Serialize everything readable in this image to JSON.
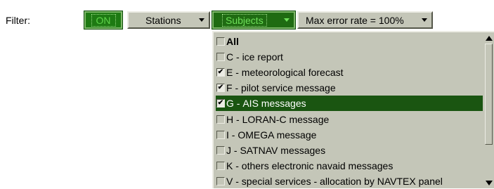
{
  "toolbar": {
    "filter_label": "Filter:",
    "on_label": "ON",
    "stations_label": "Stations",
    "subjects_label": "Subjects",
    "max_error_label": "Max error rate = 100%"
  },
  "subjects_list": {
    "items": [
      {
        "prefix": "",
        "text": "All",
        "checked": false,
        "selected": false
      },
      {
        "prefix": "C - ",
        "text": "ice report",
        "checked": false,
        "selected": false
      },
      {
        "prefix": "E - ",
        "text": "meteorological forecast",
        "checked": true,
        "selected": false
      },
      {
        "prefix": "F - ",
        "text": "pilot service message",
        "checked": true,
        "selected": false
      },
      {
        "prefix": "G - ",
        "text": "AIS messages",
        "checked": true,
        "selected": true
      },
      {
        "prefix": "H - ",
        "text": "LORAN-C message",
        "checked": false,
        "selected": false
      },
      {
        "prefix": "I - ",
        "text": "OMEGA message",
        "checked": false,
        "selected": false
      },
      {
        "prefix": "J - ",
        "text": "SATNAV messages",
        "checked": false,
        "selected": false
      },
      {
        "prefix": "K - ",
        "text": "others electronic navaid messages",
        "checked": false,
        "selected": false
      },
      {
        "prefix": "V - ",
        "text": "special services - allocation by NAVTEX panel",
        "checked": false,
        "selected": false
      }
    ]
  },
  "colors": {
    "panel": "#c4c6b8",
    "active_green": "#1f6b12",
    "selected_row": "#1a5511"
  }
}
